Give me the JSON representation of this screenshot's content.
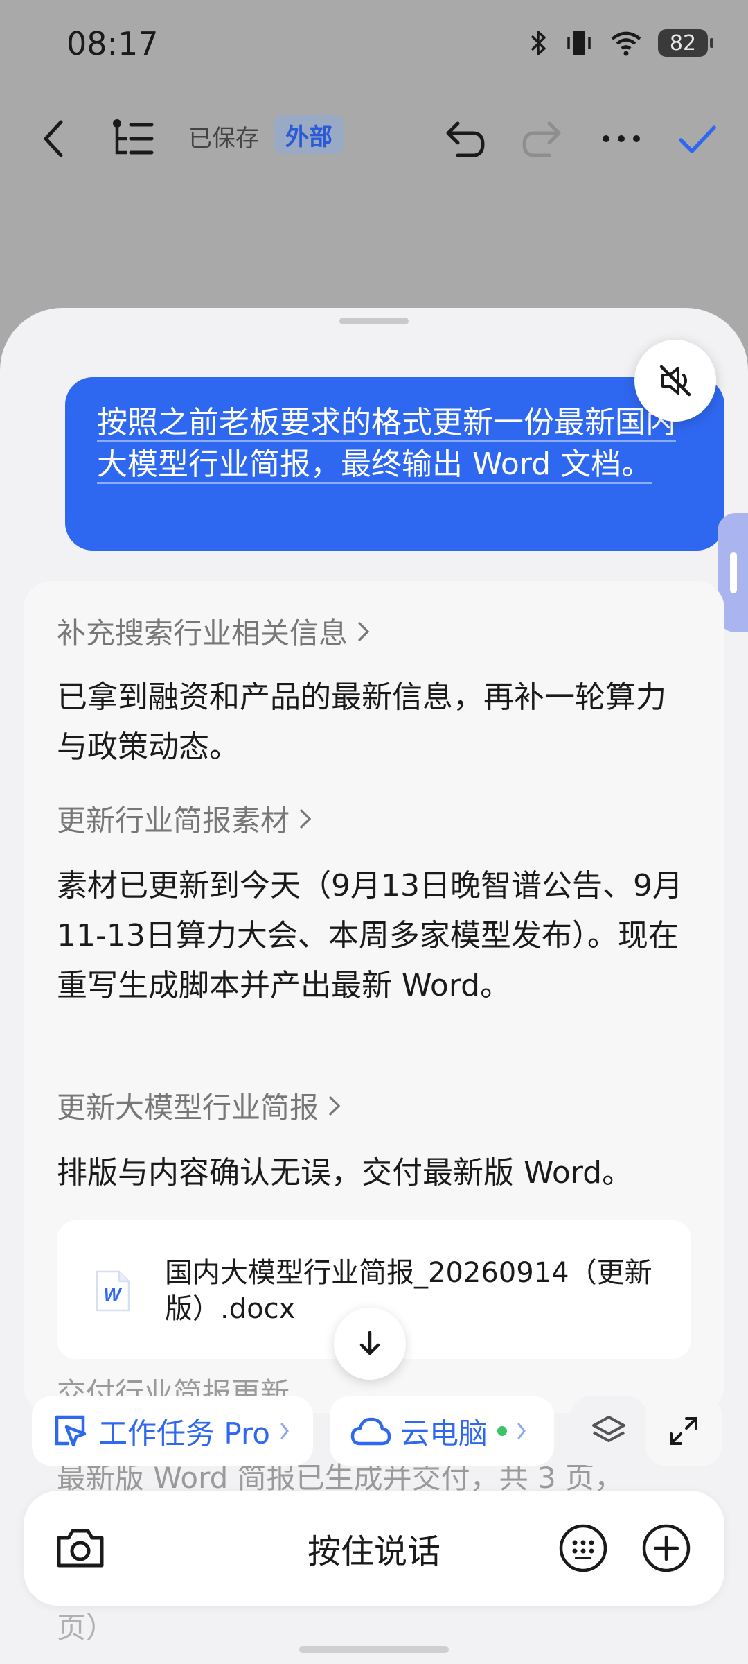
{
  "status_bar": {
    "time": "08:17",
    "battery": "82"
  },
  "toolbar": {
    "saved_label": "已保存",
    "external_badge": "外部"
  },
  "chat": {
    "user_message": "按照之前老板要求的格式更新一份最新国内大模型行业简报，最终输出 Word 文档。",
    "steps": [
      {
        "title": "补充搜索行业相关信息",
        "body": "已拿到融资和产品的最新信息，再补一轮算力与政策动态。"
      },
      {
        "title": "更新行业简报素材",
        "body": "素材已更新到今天（9月13日晚智谱公告、9月11-13日算力大会、本周多家模型发布）。现在重写生成脚本并产出最新 Word。"
      },
      {
        "title": "更新大模型行业简报",
        "body": "排版与内容确认无误，交付最新版 Word。"
      }
    ],
    "file": {
      "name": "国内大模型行业简报_20260914（更新版）.docx",
      "icon_letter": "W"
    },
    "faded_title": "交付行业简报更新",
    "faded_body": "最新版 Word 简报已生成并交付，共 3 页，",
    "faded_tail": "页）"
  },
  "chips": {
    "work_task": "工作任务 Pro",
    "cloud_pc": "云电脑"
  },
  "input_bar": {
    "hold_to_talk": "按住说话"
  },
  "colors": {
    "accent": "#2f68f0",
    "status_dot": "#3cc46a"
  }
}
